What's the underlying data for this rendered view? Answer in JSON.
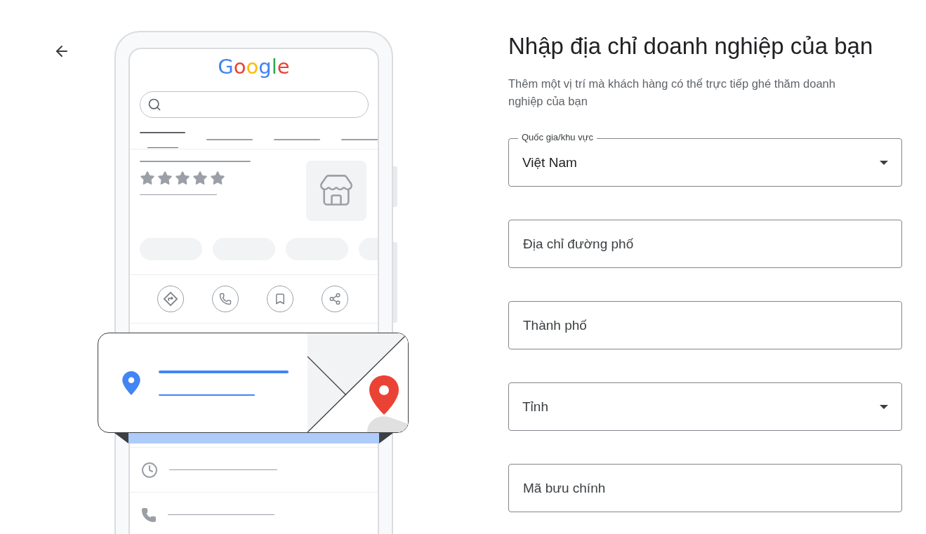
{
  "illustration": {
    "logo": [
      {
        "char": "G",
        "color": "#4285f4"
      },
      {
        "char": "o",
        "color": "#ea4335"
      },
      {
        "char": "o",
        "color": "#fbbc05"
      },
      {
        "char": "g",
        "color": "#4285f4"
      },
      {
        "char": "l",
        "color": "#34a853"
      },
      {
        "char": "e",
        "color": "#ea4335"
      }
    ],
    "stars": 5
  },
  "title": "Nhập địa chỉ doanh nghiệp của bạn",
  "subtitle": "Thêm một vị trí mà khách hàng có thể trực tiếp ghé thăm doanh nghiệp của bạn",
  "fields": [
    {
      "kind": "select",
      "label": "Quốc gia/khu vực",
      "value": "Việt Nam"
    },
    {
      "kind": "text",
      "placeholder": "Địa chỉ đường phố"
    },
    {
      "kind": "text",
      "placeholder": "Thành phố"
    },
    {
      "kind": "select",
      "placeholder": "Tỉnh"
    },
    {
      "kind": "text",
      "placeholder": "Mã bưu chính"
    }
  ]
}
